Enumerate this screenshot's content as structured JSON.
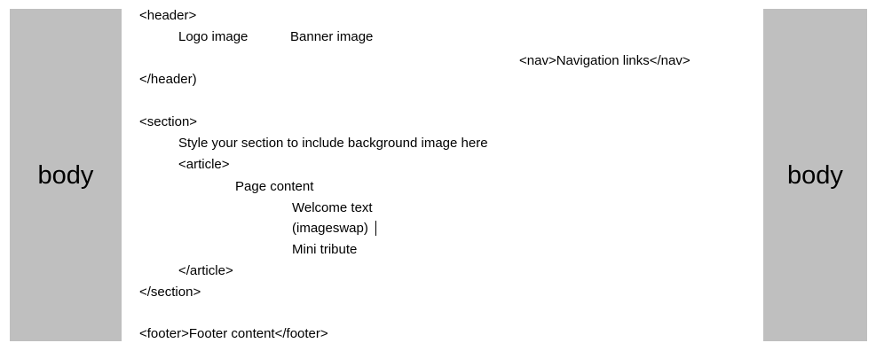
{
  "panels": {
    "left_label": "body",
    "right_label": "body"
  },
  "header": {
    "open_tag": "<header>",
    "logo": "Logo image",
    "banner": "Banner image",
    "nav": "<nav>Navigation links</nav>",
    "close_tag": "</header)"
  },
  "section": {
    "open_tag": "<section>",
    "style_note": "Style your section to include background image here",
    "article": {
      "open_tag": "<article>",
      "page_content": "Page content",
      "items": [
        "Welcome text",
        "(imageswap)",
        "Mini tribute"
      ],
      "close_tag": "</article>"
    },
    "close_tag": "</section>"
  },
  "footer": {
    "line": "<footer>Footer content</footer>"
  }
}
